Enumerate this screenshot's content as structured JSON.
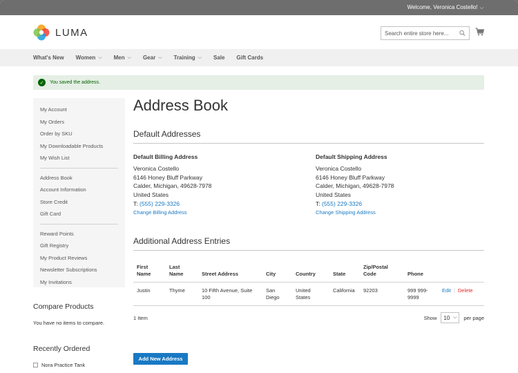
{
  "topbar": {
    "welcome": "Welcome, Veronica Costello!",
    "chevron": "⌵"
  },
  "logo": {
    "text": "LUMA"
  },
  "search": {
    "placeholder": "Search entire store here..."
  },
  "nav": [
    {
      "label": "What's New",
      "has_menu": false
    },
    {
      "label": "Women",
      "has_menu": true
    },
    {
      "label": "Men",
      "has_menu": true
    },
    {
      "label": "Gear",
      "has_menu": true
    },
    {
      "label": "Training",
      "has_menu": true
    },
    {
      "label": "Sale",
      "has_menu": false
    },
    {
      "label": "Gift Cards",
      "has_menu": false
    }
  ],
  "message": {
    "text": "You saved the address.",
    "icon": "✓"
  },
  "sidebar": {
    "group1": [
      "My Account",
      "My Orders",
      "Order by SKU",
      "My Downloadable Products",
      "My Wish List"
    ],
    "group2": [
      "Address Book",
      "Account Information",
      "Store Credit",
      "Gift Card"
    ],
    "group3": [
      "Reward Points",
      "Gift Registry",
      "My Product Reviews",
      "Newsletter Subscriptions",
      "My Invitations"
    ]
  },
  "compare": {
    "title": "Compare Products",
    "empty": "You have no items to compare."
  },
  "recent": {
    "title": "Recently Ordered",
    "item": "Nora Practice Tank"
  },
  "page_title": "Address Book",
  "default_addresses": {
    "title": "Default Addresses",
    "billing": {
      "title": "Default Billing Address",
      "name": "Veronica Costello",
      "street": "6146 Honey Bluff Parkway",
      "city_line": "Calder, Michigan, 49628-7978",
      "country": "United States",
      "phone_prefix": "T: ",
      "phone": "(555) 229-3326",
      "action": "Change Billing Address"
    },
    "shipping": {
      "title": "Default Shipping Address",
      "name": "Veronica Costello",
      "street": "6146 Honey Bluff Parkway",
      "city_line": "Calder, Michigan, 49628-7978",
      "country": "United States",
      "phone_prefix": "T: ",
      "phone": "(555) 229-3326",
      "action": "Change Shipping Address"
    }
  },
  "additional": {
    "title": "Additional Address Entries",
    "columns": [
      "First Name",
      "Last Name",
      "Street Address",
      "City",
      "Country",
      "State",
      "Zip/Postal Code",
      "Phone"
    ],
    "rows": [
      {
        "first": "Justin",
        "last": "Thyme",
        "street": "10 Fifth Avenue, Suite 100",
        "city": "San Diego",
        "country": "United States",
        "state": "California",
        "zip": "92203",
        "phone": "999 999-9999",
        "edit": "Edit",
        "delete": "Delete"
      }
    ]
  },
  "pager": {
    "count": "1 Item",
    "show": "Show",
    "limit": "10",
    "per_page": "per page"
  },
  "add_button": "Add New Address",
  "colors": {
    "accent": "#1979c3",
    "success_bg": "#e5efe5",
    "success_text": "#006400",
    "danger": "#e02b27"
  },
  "icons": {
    "search": "search-icon",
    "cart": "cart-icon",
    "chevron": "chevron-down-icon",
    "check": "check-icon"
  }
}
